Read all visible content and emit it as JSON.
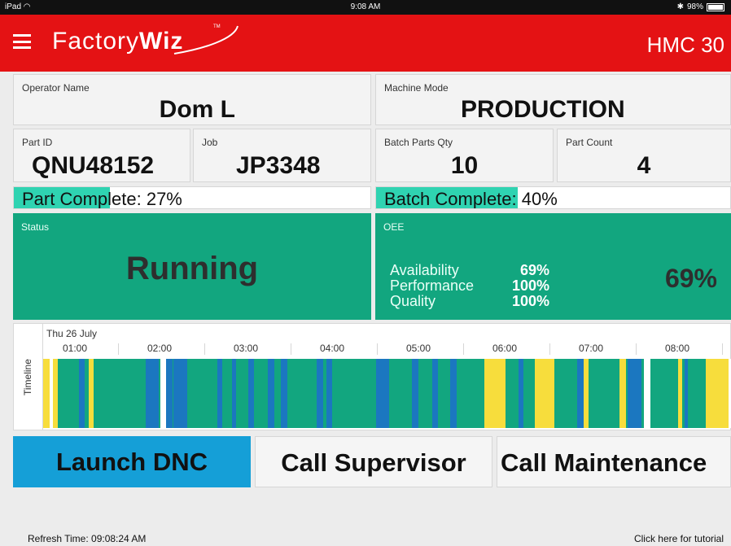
{
  "status_bar": {
    "device": "iPad",
    "time": "9:08 AM",
    "battery": "98%"
  },
  "header": {
    "brand_light": "Factory",
    "brand_bold": "Wiz",
    "brand_tm": "TM",
    "machine": "HMC 30"
  },
  "operator": {
    "label": "Operator Name",
    "value": "Dom L"
  },
  "machine_mode": {
    "label": "Machine Mode",
    "value": "PRODUCTION"
  },
  "part_id": {
    "label": "Part ID",
    "value": "QNU48152"
  },
  "job": {
    "label": "Job",
    "value": "JP3348"
  },
  "batch_qty": {
    "label": "Batch Parts Qty",
    "value": "10"
  },
  "part_count": {
    "label": "Part Count",
    "value": "4"
  },
  "part_complete": {
    "text": "Part Complete: 27%",
    "percent": 27
  },
  "batch_complete": {
    "text": "Batch Complete: 40%",
    "percent": 40
  },
  "status": {
    "label": "Status",
    "value": "Running"
  },
  "oee": {
    "label": "OEE",
    "availability_label": "Availability",
    "availability": "69%",
    "performance_label": "Performance",
    "performance": "100%",
    "quality_label": "Quality",
    "quality": "100%",
    "total": "69%"
  },
  "timeline": {
    "side_label": "Timeline",
    "date": "Thu 26 July",
    "ticks": [
      "01:00",
      "02:00",
      "03:00",
      "04:00",
      "05:00",
      "06:00",
      "07:00",
      "08:00"
    ],
    "colors": {
      "running": "#12a67f",
      "idle": "#f7dd3c",
      "setup": "#1b77c0",
      "off": "#ffffff"
    }
  },
  "buttons": {
    "launch": "Launch DNC",
    "supervisor": "Call Supervisor",
    "maintenance": "Call Maintenance"
  },
  "footer": {
    "refresh": "Refresh Time: 09:08:24 AM",
    "tutorial": "Click here for tutorial"
  }
}
